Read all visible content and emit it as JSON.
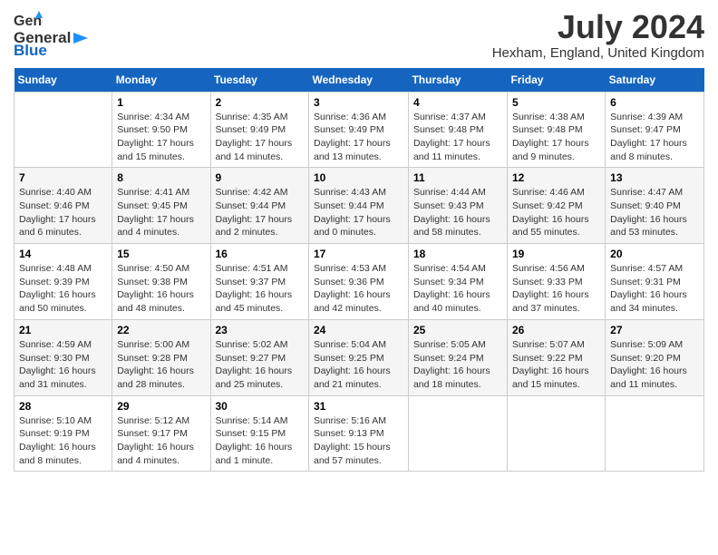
{
  "header": {
    "logo_general": "General",
    "logo_blue": "Blue",
    "month_title": "July 2024",
    "location": "Hexham, England, United Kingdom"
  },
  "days_of_week": [
    "Sunday",
    "Monday",
    "Tuesday",
    "Wednesday",
    "Thursday",
    "Friday",
    "Saturday"
  ],
  "weeks": [
    [
      {
        "day": "",
        "content": ""
      },
      {
        "day": "1",
        "content": "Sunrise: 4:34 AM\nSunset: 9:50 PM\nDaylight: 17 hours\nand 15 minutes."
      },
      {
        "day": "2",
        "content": "Sunrise: 4:35 AM\nSunset: 9:49 PM\nDaylight: 17 hours\nand 14 minutes."
      },
      {
        "day": "3",
        "content": "Sunrise: 4:36 AM\nSunset: 9:49 PM\nDaylight: 17 hours\nand 13 minutes."
      },
      {
        "day": "4",
        "content": "Sunrise: 4:37 AM\nSunset: 9:48 PM\nDaylight: 17 hours\nand 11 minutes."
      },
      {
        "day": "5",
        "content": "Sunrise: 4:38 AM\nSunset: 9:48 PM\nDaylight: 17 hours\nand 9 minutes."
      },
      {
        "day": "6",
        "content": "Sunrise: 4:39 AM\nSunset: 9:47 PM\nDaylight: 17 hours\nand 8 minutes."
      }
    ],
    [
      {
        "day": "7",
        "content": "Sunrise: 4:40 AM\nSunset: 9:46 PM\nDaylight: 17 hours\nand 6 minutes."
      },
      {
        "day": "8",
        "content": "Sunrise: 4:41 AM\nSunset: 9:45 PM\nDaylight: 17 hours\nand 4 minutes."
      },
      {
        "day": "9",
        "content": "Sunrise: 4:42 AM\nSunset: 9:44 PM\nDaylight: 17 hours\nand 2 minutes."
      },
      {
        "day": "10",
        "content": "Sunrise: 4:43 AM\nSunset: 9:44 PM\nDaylight: 17 hours\nand 0 minutes."
      },
      {
        "day": "11",
        "content": "Sunrise: 4:44 AM\nSunset: 9:43 PM\nDaylight: 16 hours\nand 58 minutes."
      },
      {
        "day": "12",
        "content": "Sunrise: 4:46 AM\nSunset: 9:42 PM\nDaylight: 16 hours\nand 55 minutes."
      },
      {
        "day": "13",
        "content": "Sunrise: 4:47 AM\nSunset: 9:40 PM\nDaylight: 16 hours\nand 53 minutes."
      }
    ],
    [
      {
        "day": "14",
        "content": "Sunrise: 4:48 AM\nSunset: 9:39 PM\nDaylight: 16 hours\nand 50 minutes."
      },
      {
        "day": "15",
        "content": "Sunrise: 4:50 AM\nSunset: 9:38 PM\nDaylight: 16 hours\nand 48 minutes."
      },
      {
        "day": "16",
        "content": "Sunrise: 4:51 AM\nSunset: 9:37 PM\nDaylight: 16 hours\nand 45 minutes."
      },
      {
        "day": "17",
        "content": "Sunrise: 4:53 AM\nSunset: 9:36 PM\nDaylight: 16 hours\nand 42 minutes."
      },
      {
        "day": "18",
        "content": "Sunrise: 4:54 AM\nSunset: 9:34 PM\nDaylight: 16 hours\nand 40 minutes."
      },
      {
        "day": "19",
        "content": "Sunrise: 4:56 AM\nSunset: 9:33 PM\nDaylight: 16 hours\nand 37 minutes."
      },
      {
        "day": "20",
        "content": "Sunrise: 4:57 AM\nSunset: 9:31 PM\nDaylight: 16 hours\nand 34 minutes."
      }
    ],
    [
      {
        "day": "21",
        "content": "Sunrise: 4:59 AM\nSunset: 9:30 PM\nDaylight: 16 hours\nand 31 minutes."
      },
      {
        "day": "22",
        "content": "Sunrise: 5:00 AM\nSunset: 9:28 PM\nDaylight: 16 hours\nand 28 minutes."
      },
      {
        "day": "23",
        "content": "Sunrise: 5:02 AM\nSunset: 9:27 PM\nDaylight: 16 hours\nand 25 minutes."
      },
      {
        "day": "24",
        "content": "Sunrise: 5:04 AM\nSunset: 9:25 PM\nDaylight: 16 hours\nand 21 minutes."
      },
      {
        "day": "25",
        "content": "Sunrise: 5:05 AM\nSunset: 9:24 PM\nDaylight: 16 hours\nand 18 minutes."
      },
      {
        "day": "26",
        "content": "Sunrise: 5:07 AM\nSunset: 9:22 PM\nDaylight: 16 hours\nand 15 minutes."
      },
      {
        "day": "27",
        "content": "Sunrise: 5:09 AM\nSunset: 9:20 PM\nDaylight: 16 hours\nand 11 minutes."
      }
    ],
    [
      {
        "day": "28",
        "content": "Sunrise: 5:10 AM\nSunset: 9:19 PM\nDaylight: 16 hours\nand 8 minutes."
      },
      {
        "day": "29",
        "content": "Sunrise: 5:12 AM\nSunset: 9:17 PM\nDaylight: 16 hours\nand 4 minutes."
      },
      {
        "day": "30",
        "content": "Sunrise: 5:14 AM\nSunset: 9:15 PM\nDaylight: 16 hours\nand 1 minute."
      },
      {
        "day": "31",
        "content": "Sunrise: 5:16 AM\nSunset: 9:13 PM\nDaylight: 15 hours\nand 57 minutes."
      },
      {
        "day": "",
        "content": ""
      },
      {
        "day": "",
        "content": ""
      },
      {
        "day": "",
        "content": ""
      }
    ]
  ]
}
